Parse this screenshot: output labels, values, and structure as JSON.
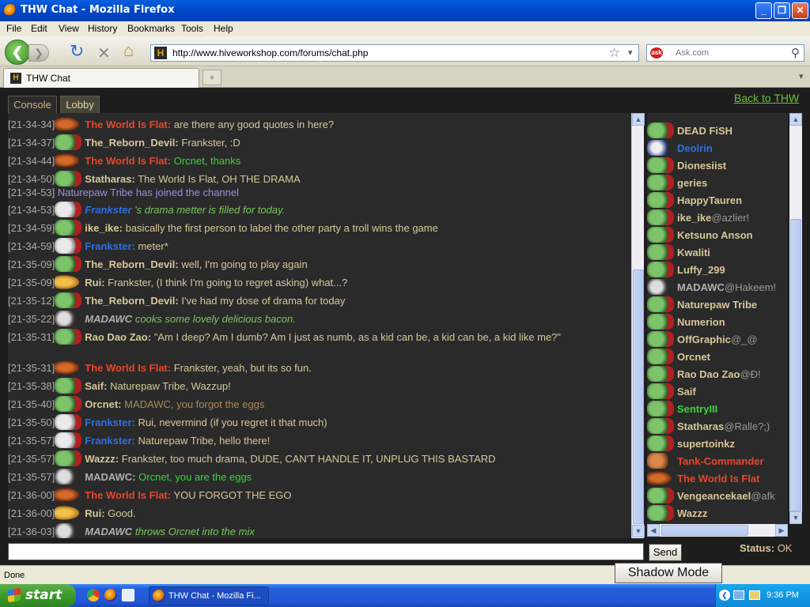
{
  "window": {
    "title": "THW Chat - Mozilla Firefox",
    "min": "_",
    "max": "❐",
    "close": "✕"
  },
  "menu": [
    "File",
    "Edit",
    "View",
    "History",
    "Bookmarks",
    "Tools",
    "Help"
  ],
  "nav": {
    "back": "❮",
    "forward": "❯",
    "reload": "↻",
    "stop": "✕",
    "home": "⌂",
    "favicon": "H",
    "url": "http://www.hiveworkshop.com/forums/chat.php",
    "star": "☆",
    "dropdown": "▾",
    "search_engine": "ask",
    "search_placeholder": "Ask.com",
    "search_go": "⚲"
  },
  "tabs": [
    {
      "label": "THW Chat",
      "icon": "H"
    }
  ],
  "new_tab": "+",
  "tab_menu": "▾",
  "chat": {
    "tabs": [
      "Console",
      "Lobby"
    ],
    "back_link": "Back to THW",
    "messages": [
      {
        "time": "[21-34-34]",
        "avatar": "flat",
        "user": "The World Is Flat:",
        "ucls": "red",
        "text": "are there any good quotes in here?",
        "tcls": "tan"
      },
      {
        "time": "[21-34-37]",
        "avatar": "orc",
        "user": "The_Reborn_Devil:",
        "ucls": "tan",
        "text": "Frankster, :D",
        "tcls": "tan"
      },
      {
        "time": "[21-34-44]",
        "avatar": "flat",
        "user": "The World Is Flat:",
        "ucls": "red",
        "text": "Orcnet, thanks",
        "tcls": "green"
      },
      {
        "time": "[21-34-50]",
        "avatar": "orc",
        "user": "Statharas:",
        "ucls": "tan",
        "text": "The World Is Flat, OH THE DRAMA",
        "tcls": "tan"
      },
      {
        "time": "[21-34-53]",
        "avatar": "",
        "user": "Naturepaw Tribe",
        "ucls": "purple",
        "text": "has joined the channel",
        "tcls": "purple",
        "plain": true
      },
      {
        "time": "[21-34-53]",
        "avatar": "white",
        "user": "Frankster",
        "ucls": "blue ital",
        "text": "'s drama metter is filled for today.",
        "tcls": "lime ital"
      },
      {
        "time": "[21-34-59]",
        "avatar": "orc",
        "user": "ike_ike:",
        "ucls": "tan",
        "text": "basically the first person to label the other party a troll wins the game",
        "tcls": "tan"
      },
      {
        "time": "[21-34-59]",
        "avatar": "white",
        "user": "Frankster:",
        "ucls": "blue",
        "text": "meter*",
        "tcls": "tan"
      },
      {
        "time": "[21-35-09]",
        "avatar": "orc",
        "user": "The_Reborn_Devil:",
        "ucls": "tan",
        "text": "well, I'm going to play again",
        "tcls": "tan"
      },
      {
        "time": "[21-35-09]",
        "avatar": "rui",
        "user": "Rui:",
        "ucls": "tan",
        "text": "Frankster, (I think I'm going to regret asking) what...?",
        "tcls": "tan"
      },
      {
        "time": "[21-35-12]",
        "avatar": "orc",
        "user": "The_Reborn_Devil:",
        "ucls": "tan",
        "text": "I've had my dose of drama for today",
        "tcls": "tan"
      },
      {
        "time": "[21-35-22]",
        "avatar": "mad",
        "user": "MADAWC",
        "ucls": "grey ital",
        "text": "cooks some lovely delicious bacon.",
        "tcls": "lime ital"
      },
      {
        "time": "[21-35-31]",
        "avatar": "orc",
        "user": "Rao Dao Zao:",
        "ucls": "tan",
        "text": "\"Am I deep? Am I dumb? Am I just as numb, as a kid can be, a kid can be, a kid like me?\"",
        "tcls": "tan",
        "wrap": true
      },
      {
        "time": "[21-35-31]",
        "avatar": "flat",
        "user": "The World Is Flat:",
        "ucls": "red",
        "text": "Frankster, yeah, but its so fun.",
        "tcls": "tan"
      },
      {
        "time": "[21-35-38]",
        "avatar": "orc",
        "user": "Saif:",
        "ucls": "tan",
        "text": "Naturepaw Tribe, Wazzup!",
        "tcls": "tan"
      },
      {
        "time": "[21-35-40]",
        "avatar": "orc",
        "user": "Orcnet:",
        "ucls": "tan",
        "text": "MADAWC, you forgot the eggs",
        "tcls": "dim"
      },
      {
        "time": "[21-35-50]",
        "avatar": "white",
        "user": "Frankster:",
        "ucls": "blue",
        "text": "Rui, nevermind (if you regret it that much)",
        "tcls": "tan"
      },
      {
        "time": "[21-35-57]",
        "avatar": "white",
        "user": "Frankster:",
        "ucls": "blue",
        "text": "Naturepaw Tribe, hello there!",
        "tcls": "tan"
      },
      {
        "time": "[21-35-57]",
        "avatar": "orc",
        "user": "Wazzz:",
        "ucls": "tan",
        "text": "Frankster, too much drama, DUDE, CAN'T HANDLE IT, UNPLUG THIS BASTARD",
        "tcls": "tan"
      },
      {
        "time": "[21-35-57]",
        "avatar": "mad",
        "user": "MADAWC:",
        "ucls": "grey",
        "text": "Orcnet, you are the eggs",
        "tcls": "green"
      },
      {
        "time": "[21-36-00]",
        "avatar": "flat",
        "user": "The World Is Flat:",
        "ucls": "red",
        "text": "YOU FORGOT THE EGO",
        "tcls": "tan"
      },
      {
        "time": "[21-36-00]",
        "avatar": "rui",
        "user": "Rui:",
        "ucls": "tan",
        "text": "Good.",
        "tcls": "tan"
      },
      {
        "time": "[21-36-03]",
        "avatar": "mad",
        "user": "MADAWC",
        "ucls": "grey ital",
        "text": "throws Orcnet into the mix",
        "tcls": "lime ital"
      }
    ],
    "users": [
      {
        "name": "DEAD FiSH",
        "suffix": "",
        "avatar": "orc",
        "cls": "tan"
      },
      {
        "name": "Deolrin",
        "suffix": "",
        "avatar": "blue",
        "cls": "blue"
      },
      {
        "name": "Dionesiist",
        "suffix": "",
        "avatar": "orc",
        "cls": "tan"
      },
      {
        "name": "geries",
        "suffix": "",
        "avatar": "orc",
        "cls": "tan"
      },
      {
        "name": "HappyTauren",
        "suffix": "",
        "avatar": "orc",
        "cls": "tan"
      },
      {
        "name": "ike_ike",
        "suffix": "@azlier!",
        "avatar": "orc",
        "cls": "tan"
      },
      {
        "name": "Ketsuno Anson",
        "suffix": "",
        "avatar": "orc",
        "cls": "tan"
      },
      {
        "name": "Kwaliti",
        "suffix": "",
        "avatar": "orc",
        "cls": "tan"
      },
      {
        "name": "Luffy_299",
        "suffix": "",
        "avatar": "orc",
        "cls": "tan"
      },
      {
        "name": "MADAWC",
        "suffix": "@Hakeem!",
        "avatar": "mad",
        "cls": "grey"
      },
      {
        "name": "Naturepaw Tribe",
        "suffix": "",
        "avatar": "orc",
        "cls": "tan"
      },
      {
        "name": "Numerion",
        "suffix": "",
        "avatar": "orc",
        "cls": "tan"
      },
      {
        "name": "OffGraphic",
        "suffix": "@_@",
        "avatar": "orc",
        "cls": "tan"
      },
      {
        "name": "Orcnet",
        "suffix": "",
        "avatar": "orc",
        "cls": "tan"
      },
      {
        "name": "Rao Dao Zao",
        "suffix": "@Ð!",
        "avatar": "orc",
        "cls": "tan"
      },
      {
        "name": "Saif",
        "suffix": "",
        "avatar": "orc",
        "cls": "tan"
      },
      {
        "name": "SentryIII",
        "suffix": "",
        "avatar": "orc",
        "cls": "green"
      },
      {
        "name": "Statharas",
        "suffix": "@Ralle?;)",
        "avatar": "orc",
        "cls": "tan"
      },
      {
        "name": "supertoinkz",
        "suffix": "",
        "avatar": "orc",
        "cls": "tan"
      },
      {
        "name": "Tank-Commander",
        "suffix": "",
        "avatar": "tank",
        "cls": "red"
      },
      {
        "name": "The World Is Flat",
        "suffix": "",
        "avatar": "flat",
        "cls": "red"
      },
      {
        "name": "Vengeancekael",
        "suffix": "@afk",
        "avatar": "orc",
        "cls": "tan"
      },
      {
        "name": "Wazzz",
        "suffix": "",
        "avatar": "orc",
        "cls": "tan"
      }
    ],
    "input_value": "",
    "send_label": "Send",
    "status_label": "Status:",
    "status_value": "OK"
  },
  "statusbar": {
    "text": "Done",
    "shadow_mode": "Shadow Mode"
  },
  "taskbar": {
    "start": "start",
    "task": "THW Chat - Mozilla Fi...",
    "clock": "9:36 PM"
  }
}
